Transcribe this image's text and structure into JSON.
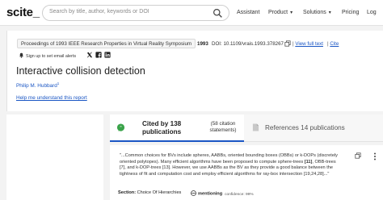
{
  "header": {
    "logo": "scite_",
    "search_placeholder": "Search by title, author, keywords or DOI",
    "nav": {
      "assistant": "Assistant",
      "product": "Product",
      "solutions": "Solutions",
      "pricing": "Pricing",
      "login": "Log"
    }
  },
  "paper": {
    "source": "Proceedings of 1993 IEEE Research Properties in Virtual Reality Symposium",
    "year": "1993",
    "doi": "DOI: 10.1109/vrais.1993.378267",
    "full_text_link": "View full text",
    "cite_link": "Cite",
    "alerts_text": "Sign up to set email alerts",
    "title": "Interactive collision detection",
    "author": "Philip M. Hubbard",
    "author_sup": "1",
    "help_link": "Help me understand this report"
  },
  "tabs": {
    "cited_by": "Cited by 138 publications",
    "citation_statements": "(58 citation statements)",
    "references": "References 14 publications"
  },
  "snippet": {
    "text_1": "\"...Common choices for BVs include spheres, AABBs, oriented bounding boxes (OBBs) or k-DOPs (discretely oriented polytopes). Many efficient algorithms have been proposed to compute sphere-trees",
    "ref_1": "[11]",
    "text_2": ", OBB-trees [7], and k-DOP-trees [13]. However, we use AABBs as the BV as they provide a good balance between the tightness of fit and computation cost and employ efficient algorithms for ray-box intersection [19,24,28]...\"",
    "section_label": "Section:",
    "section_value": "Choice Of Hierarchies",
    "mention_label": "mentioning",
    "confidence": "confidence: 99%"
  },
  "colors": {
    "link": "#1a56c4",
    "mention": "#3a3a3a",
    "cited_icon": "#3aa34a"
  },
  "icons": [
    "search-icon",
    "copy-icon",
    "bell-icon",
    "twitter-icon",
    "facebook-icon",
    "linkedin-icon",
    "chat-quote-icon",
    "document-icon",
    "more-icon"
  ]
}
